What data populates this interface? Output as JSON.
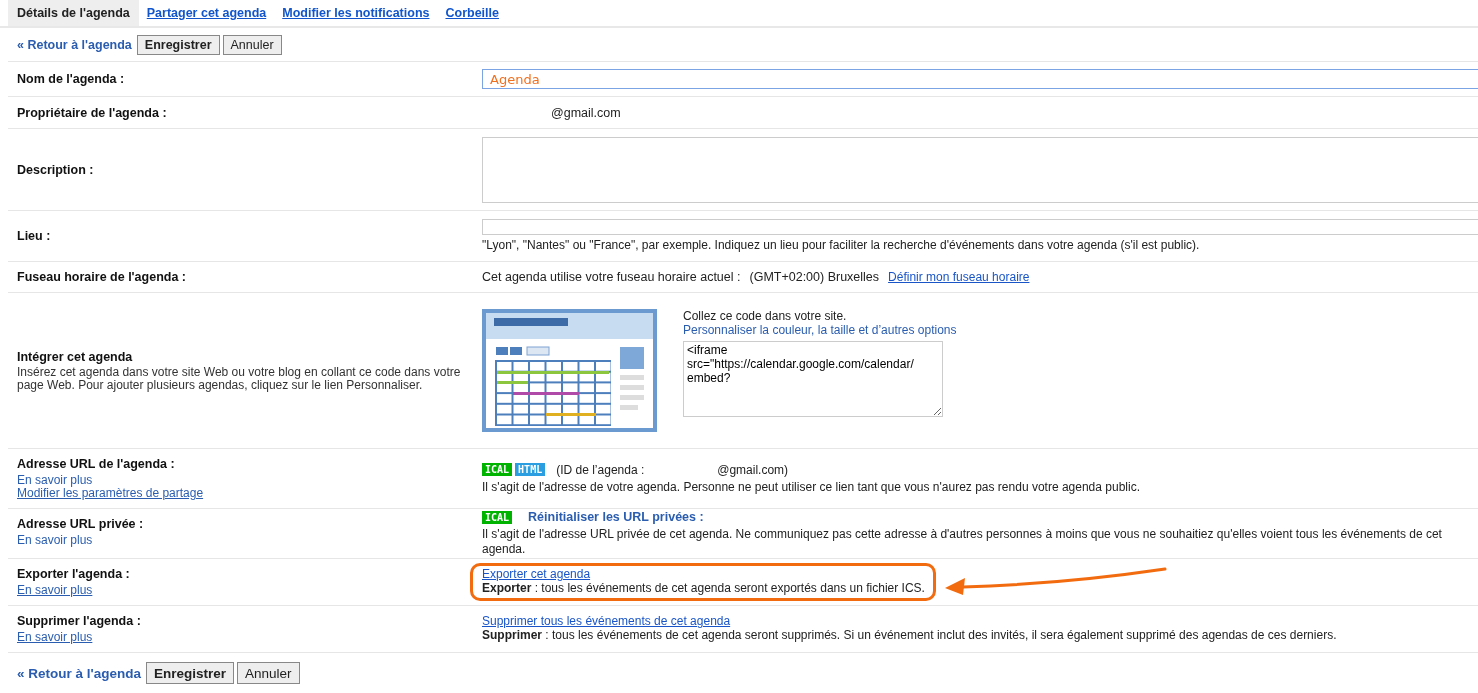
{
  "tabs": [
    {
      "label": "Détails de l'agenda",
      "selected": true
    },
    {
      "label": "Partager cet agenda",
      "selected": false
    },
    {
      "label": "Modifier les notifications",
      "selected": false
    },
    {
      "label": "Corbeille",
      "selected": false
    }
  ],
  "toolbar_top": {
    "back_link": "« Retour à l'agenda",
    "save": "Enregistrer",
    "cancel": "Annuler"
  },
  "rows": [
    {
      "kind": "input",
      "label": "Nom de l'agenda :",
      "value": "Agenda"
    },
    {
      "kind": "text",
      "label": "Propriétaire de l'agenda :",
      "value": "@gmail.com"
    },
    {
      "kind": "textarea",
      "label": "Description :"
    },
    {
      "kind": "input_hint",
      "label": "Lieu :",
      "hint": "\"Lyon\", \"Nantes\" ou \"France\", par exemple. Indiquez un lieu pour faciliter la recherche d'événements dans votre agenda (s'il est public)."
    },
    {
      "kind": "timezone",
      "label": "Fuseau horaire de l'agenda :",
      "text": "Cet agenda utilise votre fuseau horaire actuel :",
      "zone": "(GMT+02:00) Bruxelles",
      "link": "Définir mon fuseau horaire"
    },
    {
      "kind": "embed",
      "label": "Intégrer cet agenda",
      "description": "Insérez cet agenda dans votre site Web ou votre blog en collant ce code dans votre page Web. Pour ajouter plusieurs agendas, cliquez sur le lien Personnaliser.",
      "instruction": "Collez ce code dans votre site.",
      "link": "Personnaliser la couleur, la taille et d’autres options",
      "code": "<iframe\nsrc=\"https://calendar.google.com/calendar/\nembed?"
    },
    {
      "kind": "url",
      "label": "Adresse URL de l'agenda :",
      "links": [
        {
          "text": "En savoir plus",
          "underlined": false
        },
        {
          "text": "Modifier les paramètres de partage",
          "underlined": true
        }
      ],
      "badges": [
        {
          "text": "ICAL",
          "color": "#00b300"
        },
        {
          "text": "HTML",
          "color": "#2a9ee0"
        }
      ],
      "id_label": "(ID de l’agenda :",
      "id_value": "@gmail.com)",
      "note": "Il s'agit de l'adresse de votre agenda. Personne ne peut utiliser ce lien tant que vous n'aurez pas rendu votre agenda public."
    },
    {
      "kind": "private",
      "label": "Adresse URL privée :",
      "links": [
        {
          "text": "En savoir plus",
          "underlined": false
        }
      ],
      "badges": [
        {
          "text": "ICAL",
          "color": "#00b300"
        }
      ],
      "action": "Réinitialiser les URL privées :",
      "note": "Il s'agit de l'adresse URL privée de cet agenda. Ne communiquez pas cette adresse à d'autres personnes à moins que vous ne souhaitiez qu'elles voient tous les événements de cet agenda."
    },
    {
      "kind": "action",
      "label": "Exporter l'agenda :",
      "links": [
        {
          "text": "En savoir plus",
          "underlined": true
        }
      ],
      "action": "Exporter cet agenda",
      "note": "**Exporter** : tous les événements de cet agenda seront exportés dans un fichier ICS.",
      "highlighted": true
    },
    {
      "kind": "action",
      "label": "Supprimer l'agenda :",
      "links": [
        {
          "text": "En savoir plus",
          "underlined": true
        }
      ],
      "action": "Supprimer tous les événements de cet agenda",
      "note": "**Supprimer** : tous les événements de cet agenda seront supprimés. Si un événement inclut des invités, il sera également supprimé des agendas de ces derniers.",
      "highlighted": false
    }
  ],
  "toolbar_bottom": {
    "back_link": "« Retour à l'agenda",
    "save": "Enregistrer",
    "cancel": "Annuler"
  }
}
